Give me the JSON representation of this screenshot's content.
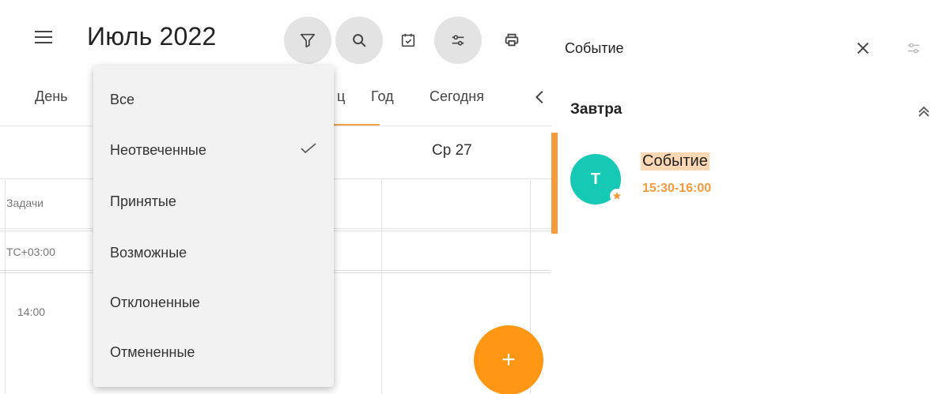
{
  "header": {
    "title": "Июль 2022"
  },
  "toolbar": {
    "filter_icon": "filter-icon",
    "search_icon": "search-icon",
    "calendar_icon": "calendar-check-icon",
    "settings_icon": "sliders-icon",
    "print_icon": "print-icon"
  },
  "views": {
    "day": "День",
    "month_partial": "ц",
    "year": "Год",
    "today": "Сегодня"
  },
  "calendar": {
    "day_header": "Ср 27",
    "tasks_label": "Задачи",
    "timezone_label": "TC+03:00",
    "time_label": "14:00",
    "add_label": "+"
  },
  "filter_menu": {
    "items": [
      "Все",
      "Неотвеченные",
      "Принятые",
      "Возможные",
      "Отклоненные",
      "Отмененные"
    ],
    "selected": "Неотвеченные"
  },
  "panel": {
    "title": "Событие",
    "group_label": "Завтра",
    "event": {
      "avatar_letter": "T",
      "title": "Событие",
      "time": "15:30-16:00"
    }
  },
  "colors": {
    "accent": "#ff9614",
    "event_bar": "#f59a3d",
    "avatar": "#15c9b4",
    "highlight": "#fbd7b4"
  }
}
